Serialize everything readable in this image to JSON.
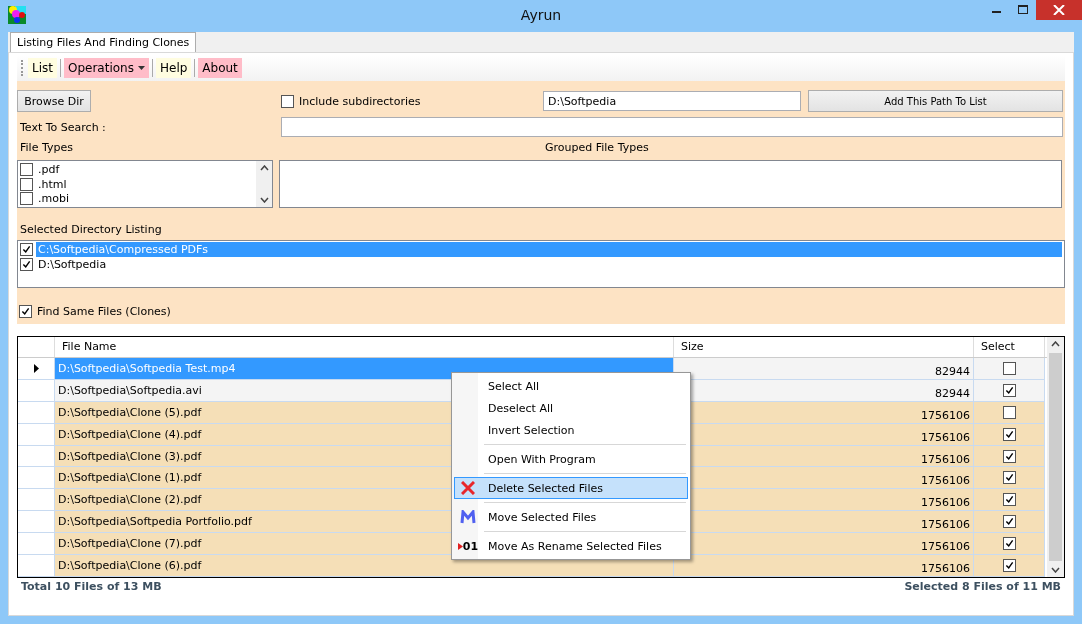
{
  "window": {
    "title": "Ayrun"
  },
  "tabs": [
    {
      "label": "Listing Files And Finding Clones",
      "selected": true
    }
  ],
  "toolbar": [
    {
      "label": "List",
      "kind": "plain",
      "color": "#fffde0"
    },
    {
      "label": "Operations",
      "kind": "dropdown",
      "color": "#ffbcc8"
    },
    {
      "label": "Help",
      "kind": "plain",
      "color": "#fffde0"
    },
    {
      "label": "About",
      "kind": "plain",
      "color": "#ffbcc8"
    }
  ],
  "form": {
    "browse_button": "Browse Dir",
    "include_subdirectories": {
      "label": "Include subdirectories",
      "checked": false
    },
    "path": "D:\\Softpedia",
    "add_button": "Add This Path To List",
    "search_label": "Text To Search :",
    "file_types_label": "File Types",
    "grouped_label": "Grouped File Types",
    "file_types": [
      {
        "label": ".pdf",
        "checked": false
      },
      {
        "label": ".html",
        "checked": false
      },
      {
        "label": ".mobi",
        "checked": false
      }
    ],
    "directory_label": "Selected Directory Listing",
    "directories": [
      {
        "path": "C:\\Softpedia\\Compressed PDFs",
        "checked": true,
        "selected": true
      },
      {
        "path": "D:\\Softpedia",
        "checked": true,
        "selected": false
      }
    ],
    "find_clones": {
      "label": "Find Same Files (Clones)",
      "checked": true
    }
  },
  "table": {
    "columns": [
      "File Name",
      "Size",
      "Select"
    ],
    "rows": [
      {
        "file": "D:\\Softpedia\\Softpedia Test.mp4",
        "size": "82944",
        "checked": false,
        "selected": true,
        "color": "#f4f4f4"
      },
      {
        "file": "D:\\Softpedia\\Softpedia.avi",
        "size": "82944",
        "checked": true,
        "selected": false,
        "color": "#f4f4f4"
      },
      {
        "file": "D:\\Softpedia\\Clone (5).pdf",
        "size": "1756106",
        "checked": false,
        "selected": false,
        "color": "#f5dfb7"
      },
      {
        "file": "D:\\Softpedia\\Clone (4).pdf",
        "size": "1756106",
        "checked": true,
        "selected": false,
        "color": "#f5dfb7"
      },
      {
        "file": "D:\\Softpedia\\Clone (3).pdf",
        "size": "1756106",
        "checked": true,
        "selected": false,
        "color": "#f5dfb7"
      },
      {
        "file": "D:\\Softpedia\\Clone (1).pdf",
        "size": "1756106",
        "checked": true,
        "selected": false,
        "color": "#f5dfb7"
      },
      {
        "file": "D:\\Softpedia\\Clone (2).pdf",
        "size": "1756106",
        "checked": true,
        "selected": false,
        "color": "#f5dfb7"
      },
      {
        "file": "D:\\Softpedia\\Softpedia Portfolio.pdf",
        "size": "1756106",
        "checked": true,
        "selected": false,
        "color": "#f5dfb7"
      },
      {
        "file": "D:\\Softpedia\\Clone (7).pdf",
        "size": "1756106",
        "checked": true,
        "selected": false,
        "color": "#f5dfb7"
      },
      {
        "file": "D:\\Softpedia\\Clone (6).pdf",
        "size": "1756106",
        "checked": true,
        "selected": false,
        "color": "#f5dfb7"
      }
    ]
  },
  "context_menu": {
    "groups": [
      [
        {
          "label": "Select All",
          "kind": "plain",
          "selected": false
        },
        {
          "label": "Deselect All",
          "kind": "plain",
          "selected": false
        },
        {
          "label": "Invert Selection",
          "kind": "plain",
          "selected": false
        }
      ],
      [
        {
          "label": "Open With Program",
          "kind": "plain",
          "selected": false
        }
      ],
      [
        {
          "label": "Delete Selected Files",
          "kind": "delete",
          "selected": true
        }
      ],
      [
        {
          "label": "Move Selected Files",
          "kind": "move",
          "selected": false
        }
      ],
      [
        {
          "label": "Move As Rename Selected Files",
          "kind": "rename",
          "icon_text": "01",
          "selected": false
        }
      ]
    ]
  },
  "status_bar": {
    "total": "Total 10 Files of 13 MB",
    "selected": "Selected 8 Files of 11 MB"
  }
}
